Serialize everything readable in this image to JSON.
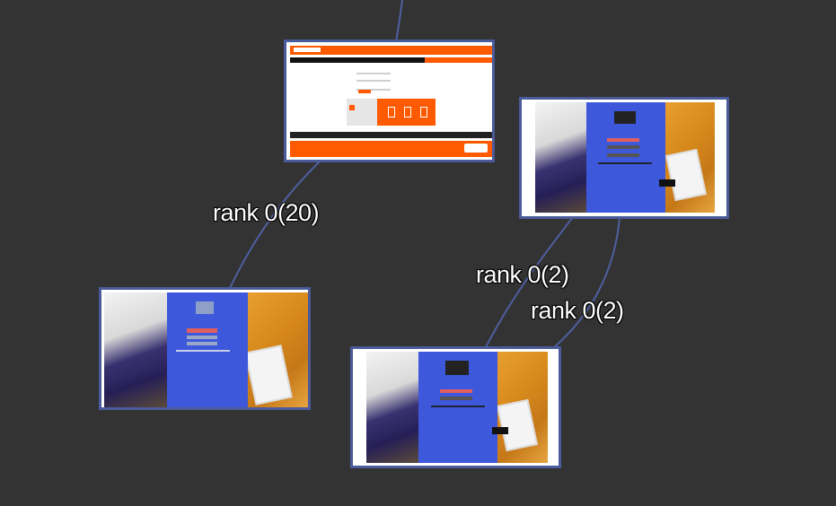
{
  "edges": [
    {
      "label": "rank 0(20)"
    },
    {
      "label": "rank 0(2)"
    },
    {
      "label": "rank 0(2)"
    }
  ],
  "colors": {
    "background": "#333333",
    "edge": "#4e5f9f",
    "node_border": "#4a5a9a",
    "panel_blue": "#3d58db",
    "brand_orange": "#ff5a00"
  },
  "nodes": [
    {
      "kind": "web-page-thumbnail"
    },
    {
      "kind": "photo-thumbnail"
    },
    {
      "kind": "photo-thumbnail"
    },
    {
      "kind": "photo-thumbnail"
    }
  ]
}
